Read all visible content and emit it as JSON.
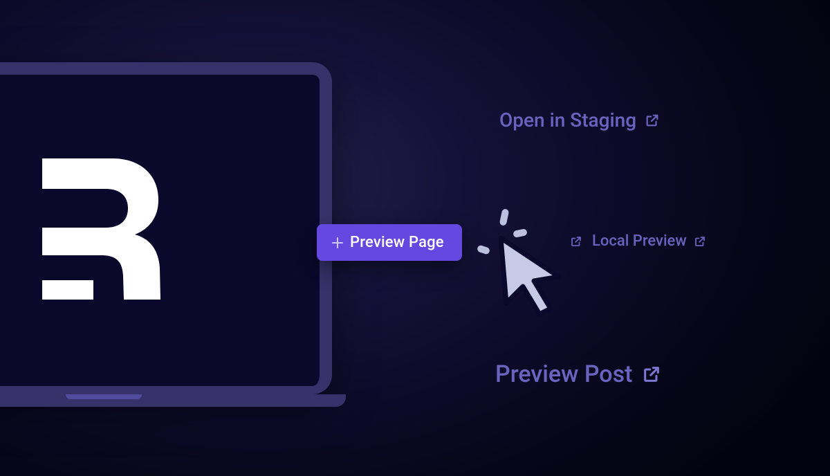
{
  "colors": {
    "accent": "#6548e0",
    "link": "#6a63c0",
    "frame": "#37326a",
    "screen_bg": "#0a082b"
  },
  "laptop": {
    "logo": "remix-logo"
  },
  "primary_button": {
    "label": "Preview Page",
    "icon": "plus"
  },
  "links": {
    "staging": {
      "label": "Open in Staging"
    },
    "local": {
      "label": "Local Preview"
    },
    "post": {
      "label": "Preview Post"
    }
  }
}
